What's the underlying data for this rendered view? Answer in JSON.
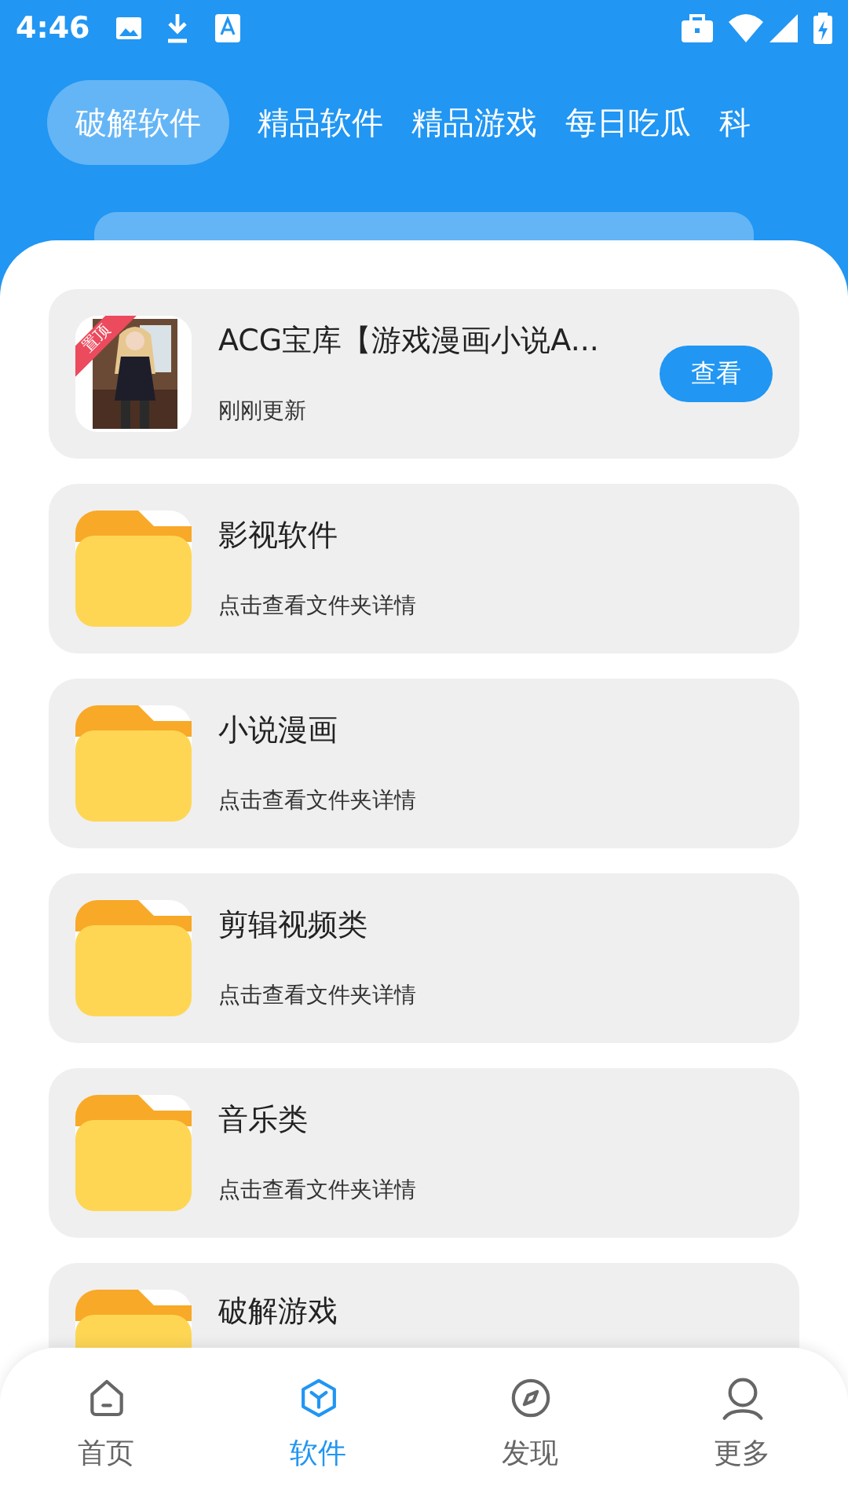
{
  "status_bar": {
    "time": "4:46"
  },
  "tabs": [
    {
      "label": "破解软件",
      "selected": true
    },
    {
      "label": "精品软件",
      "selected": false
    },
    {
      "label": "精品游戏",
      "selected": false
    },
    {
      "label": "每日吃瓜",
      "selected": false
    },
    {
      "label": "科",
      "selected": false
    }
  ],
  "items": [
    {
      "kind": "app",
      "title": "ACG宝库【游戏漫画小说A...",
      "subtitle": "刚刚更新",
      "badge": "置顶",
      "button": "查看"
    },
    {
      "kind": "folder",
      "title": "影视软件",
      "subtitle": "点击查看文件夹详情"
    },
    {
      "kind": "folder",
      "title": "小说漫画",
      "subtitle": "点击查看文件夹详情"
    },
    {
      "kind": "folder",
      "title": "剪辑视频类",
      "subtitle": "点击查看文件夹详情"
    },
    {
      "kind": "folder",
      "title": "音乐类",
      "subtitle": "点击查看文件夹详情"
    },
    {
      "kind": "folder",
      "title": "破解游戏"
    }
  ],
  "bottom_nav": [
    {
      "label": "首页",
      "kind": "home",
      "selected": false
    },
    {
      "label": "软件",
      "kind": "cube",
      "selected": true
    },
    {
      "label": "发现",
      "kind": "compass",
      "selected": false
    },
    {
      "label": "更多",
      "kind": "person",
      "selected": false
    }
  ]
}
